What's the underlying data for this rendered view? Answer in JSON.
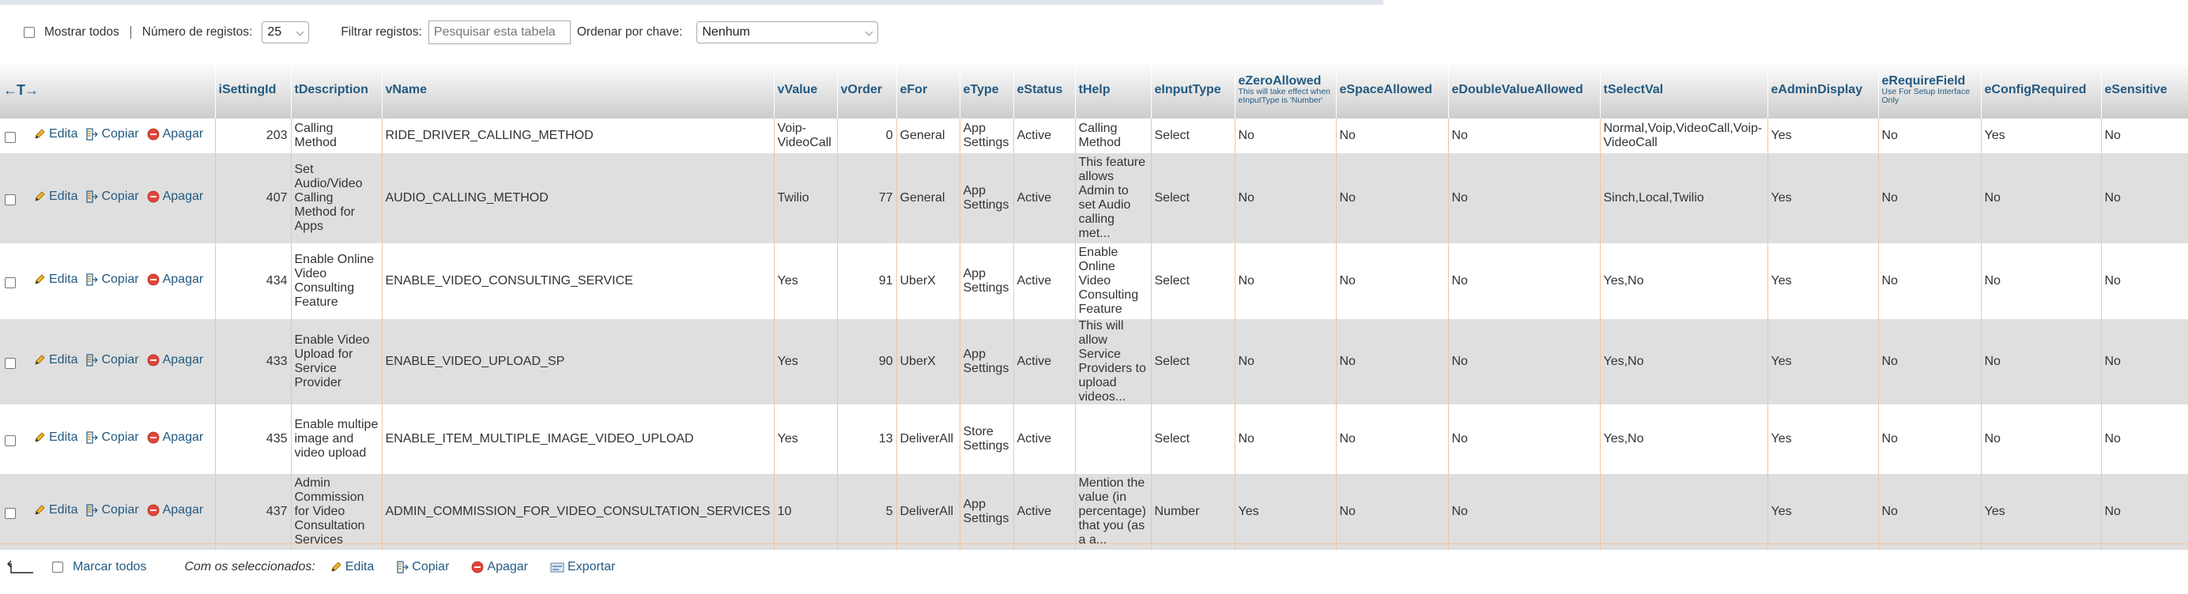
{
  "toolbar": {
    "show_all_label": "Mostrar todos",
    "num_records_label": "Número de registos:",
    "num_records_value": "25",
    "filter_label": "Filtrar registos:",
    "filter_placeholder": "Pesquisar esta tabela",
    "order_label": "Ordenar por chave:",
    "order_value": "Nenhum"
  },
  "table": {
    "arrows": "←T→",
    "columns": [
      {
        "label": "iSettingId"
      },
      {
        "label": "tDescription"
      },
      {
        "label": "vName"
      },
      {
        "label": "vValue"
      },
      {
        "label": "vOrder"
      },
      {
        "label": "eFor"
      },
      {
        "label": "eType"
      },
      {
        "label": "eStatus"
      },
      {
        "label": "tHelp"
      },
      {
        "label": "eInputType"
      },
      {
        "label": "eZeroAllowed",
        "note": "This will take effect when eInputType is 'Number'"
      },
      {
        "label": "eSpaceAllowed"
      },
      {
        "label": "eDoubleValueAllowed"
      },
      {
        "label": "tSelectVal"
      },
      {
        "label": "eAdminDisplay"
      },
      {
        "label": "eRequireField",
        "note": "Use For Setup Interface Only"
      },
      {
        "label": "eConfigRequired"
      },
      {
        "label": "eSensitive"
      }
    ],
    "actions": {
      "edit": "Edita",
      "copy": "Copiar",
      "delete": "Apagar"
    },
    "rows": [
      {
        "cells": [
          "203",
          "Calling Method",
          "RIDE_DRIVER_CALLING_METHOD",
          "Voip-VideoCall",
          "0",
          "General",
          "App Settings",
          "Active",
          "Calling Method",
          "Select",
          "No",
          "No",
          "No",
          "Normal,Voip,VideoCall,Voip-VideoCall",
          "Yes",
          "No",
          "Yes",
          "No"
        ]
      },
      {
        "cells": [
          "407",
          "Set Audio/Video Calling Method for Apps",
          "AUDIO_CALLING_METHOD",
          "Twilio",
          "77",
          "General",
          "App Settings",
          "Active",
          "This feature allows Admin to set Audio calling met...",
          "Select",
          "No",
          "No",
          "No",
          "Sinch,Local,Twilio",
          "Yes",
          "No",
          "No",
          "No"
        ]
      },
      {
        "cells": [
          "434",
          "Enable Online Video Consulting Feature",
          "ENABLE_VIDEO_CONSULTING_SERVICE",
          "Yes",
          "91",
          "UberX",
          "App Settings",
          "Active",
          "Enable Online Video Consulting Feature",
          "Select",
          "No",
          "No",
          "No",
          "Yes,No",
          "Yes",
          "No",
          "No",
          "No"
        ]
      },
      {
        "cells": [
          "433",
          "Enable Video Upload for Service Provider",
          "ENABLE_VIDEO_UPLOAD_SP",
          "Yes",
          "90",
          "UberX",
          "App Settings",
          "Active",
          "This will allow Service Providers to upload videos...",
          "Select",
          "No",
          "No",
          "No",
          "Yes,No",
          "Yes",
          "No",
          "No",
          "No"
        ]
      },
      {
        "cells": [
          "435",
          "Enable multipe image and video upload",
          "ENABLE_ITEM_MULTIPLE_IMAGE_VIDEO_UPLOAD",
          "Yes",
          "13",
          "DeliverAll",
          "Store Settings",
          "Active",
          "",
          "Select",
          "No",
          "No",
          "No",
          "Yes,No",
          "Yes",
          "No",
          "No",
          "No"
        ]
      },
      {
        "cells": [
          "437",
          "Admin Commission for Video Consultation Services",
          "ADMIN_COMMISSION_FOR_VIDEO_CONSULTATION_SERVICES",
          "10",
          "5",
          "DeliverAll",
          "App Settings",
          "Active",
          "Mention the value (in percentage) that you (as a a...",
          "Number",
          "Yes",
          "No",
          "No",
          "",
          "Yes",
          "No",
          "Yes",
          "No"
        ]
      }
    ]
  },
  "footer": {
    "check_all_label": "Marcar todos",
    "with_selected_label": "Com os seleccionados:",
    "edit_label": "Edita",
    "copy_label": "Copiar",
    "delete_label": "Apagar",
    "export_label": "Exportar"
  },
  "icons": [
    "pencil-icon",
    "copy-icon",
    "delete-icon",
    "export-icon",
    "arrow-up-icon"
  ],
  "colors": {
    "link": "#235a81",
    "row_alt": "#dfdfdf",
    "border": "#f5c49a"
  }
}
